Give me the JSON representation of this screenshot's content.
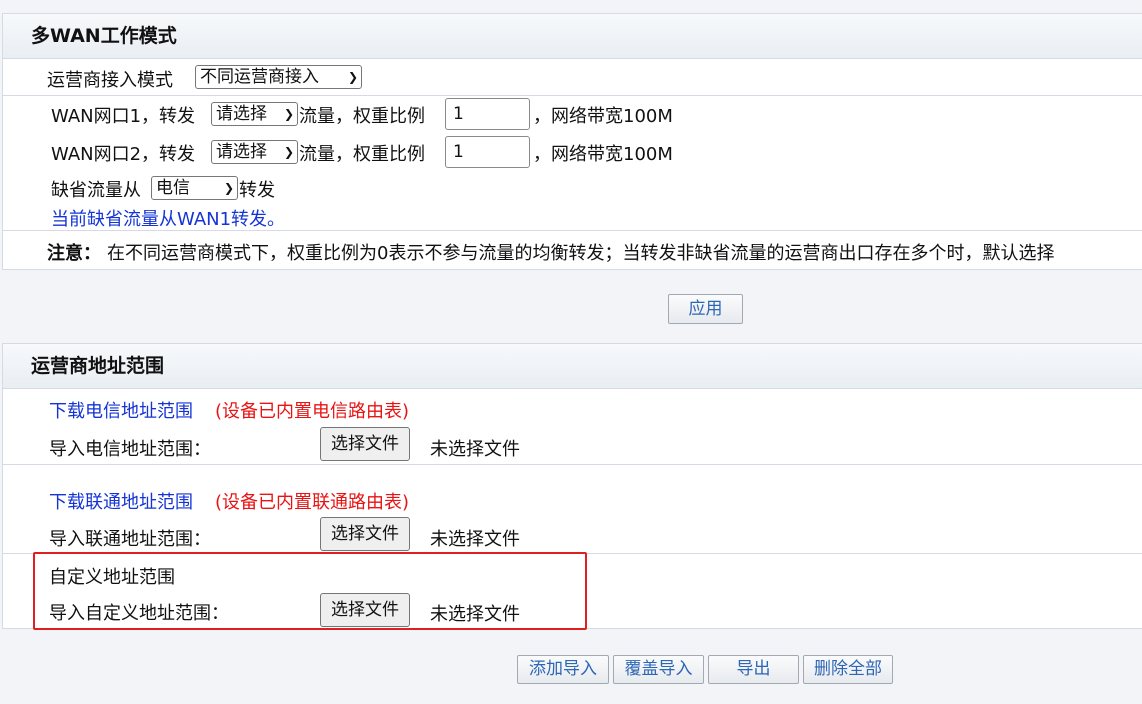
{
  "wan_mode": {
    "title": "多WAN工作模式",
    "access_mode_label": "运营商接入模式",
    "access_mode_value": "不同运营商接入",
    "wan_rows": [
      {
        "prefix": "WAN网口1，转发",
        "select": "请选择",
        "mid": "流量，权重比例",
        "weight": "1",
        "suffix": "，网络带宽100M"
      },
      {
        "prefix": "WAN网口2，转发",
        "select": "请选择",
        "mid": "流量，权重比例",
        "weight": "1",
        "suffix": "，网络带宽100M"
      }
    ],
    "default_prefix": "缺省流量从",
    "default_select": "电信",
    "default_suffix": "转发",
    "current_default": "当前缺省流量从WAN1转发。",
    "note_label": "注意：",
    "note_text": "在不同运营商模式下，权重比例为0表示不参与流量的均衡转发；当转发非缺省流量的运营商出口存在多个时，默认选择"
  },
  "apply_button": "应用",
  "isp_range": {
    "title": "运营商地址范围",
    "telecom_download": "下载电信地址范围",
    "telecom_builtin": "(设备已内置电信路由表)",
    "telecom_import_label": "导入电信地址范围：",
    "unicom_download": "下载联通地址范围",
    "unicom_builtin": "(设备已内置联通路由表)",
    "unicom_import_label": "导入联通地址范围：",
    "custom_title": "自定义地址范围",
    "custom_import_label": "导入自定义地址范围：",
    "choose_file": "选择文件",
    "no_file": "未选择文件"
  },
  "bottom_buttons": {
    "add_import": "添加导入",
    "overwrite_import": "覆盖导入",
    "export": "导出",
    "delete_all": "删除全部"
  },
  "colors": {
    "link_blue": "#1534d6",
    "warning_red": "#e81414",
    "button_text_blue": "#2d66b5",
    "highlight_red": "#e02020"
  }
}
